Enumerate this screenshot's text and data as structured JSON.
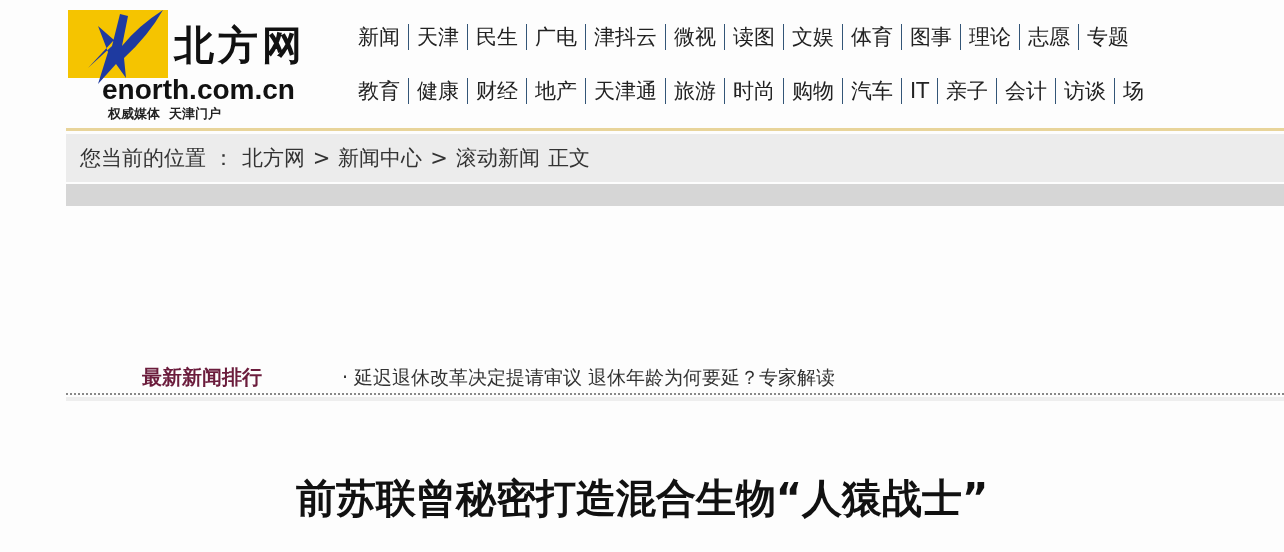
{
  "logo": {
    "name": "北方网",
    "domain": "enorth.com.cn",
    "slogan": "权威媒体  天津门户"
  },
  "nav_rows": [
    [
      "新闻",
      "天津",
      "民生",
      "广电",
      "津抖云",
      "微视",
      "读图",
      "文娱",
      "体育",
      "图事",
      "理论",
      "志愿",
      "专题"
    ],
    [
      "教育",
      "健康",
      "财经",
      "地产",
      "天津通",
      "旅游",
      "时尚",
      "购物",
      "汽车",
      "IT",
      "亲子",
      "会计",
      "访谈",
      "场"
    ]
  ],
  "breadcrumb": {
    "label": "您当前的位置 ：",
    "items": [
      "北方网",
      "新闻中心",
      "滚动新闻"
    ],
    "separator": ">",
    "current": "正文"
  },
  "ticker": {
    "label": "最新新闻排行",
    "items": [
      "· 延迟退休改革决定提请审议 退休年龄为何要延？专家解读"
    ]
  },
  "article": {
    "title": "前苏联曾秘密打造混合生物“人猿战士”"
  }
}
